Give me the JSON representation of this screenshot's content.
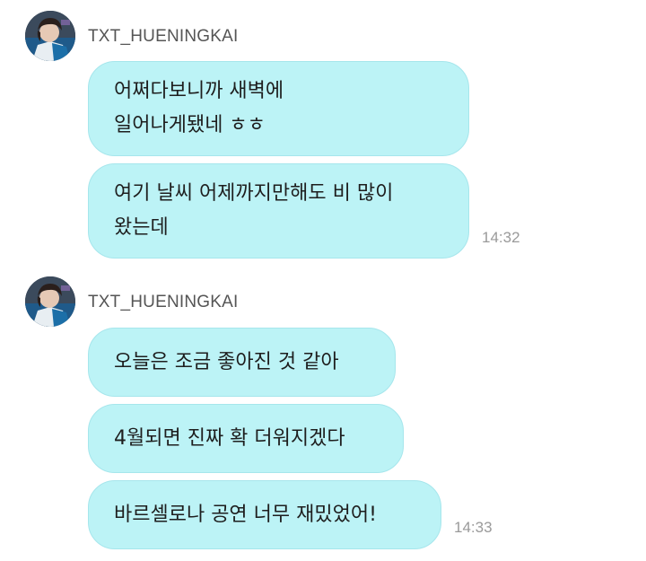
{
  "groups": [
    {
      "sender": "TXT_HUENINGKAI",
      "avatar_icon": "profile-photo-avatar",
      "messages": [
        {
          "text": "어쩌다보니까 새벽에\n일어나게됐네 ㅎㅎ"
        },
        {
          "text": "여기 날씨 어제까지만해도 비 많이\n왔는데"
        }
      ],
      "time": "14:32"
    },
    {
      "sender": "TXT_HUENINGKAI",
      "avatar_icon": "profile-photo-avatar",
      "messages": [
        {
          "text": "오늘은 조금 좋아진 것 같아"
        },
        {
          "text": "4월되면 진짜 확 더워지겠다"
        },
        {
          "text": "바르셀로나 공연 너무 재밌었어!"
        }
      ],
      "time": "14:33"
    }
  ],
  "colors": {
    "bubble_fill": "#bcf3f6",
    "bubble_border": "#a6e6ec",
    "sender_text": "#555555",
    "time_text": "#9a9a9a"
  }
}
